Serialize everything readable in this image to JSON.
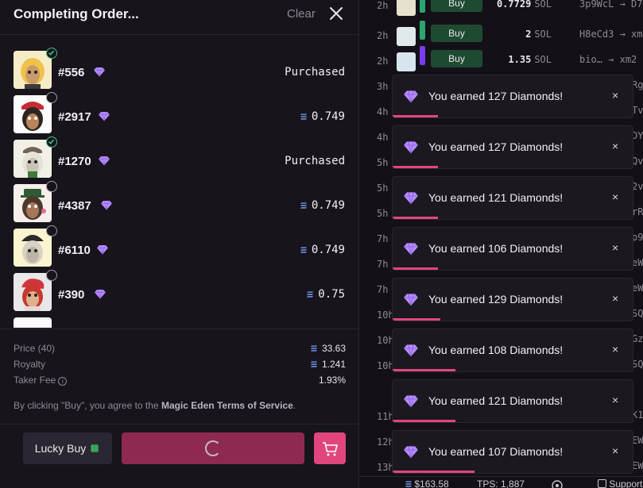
{
  "order_panel": {
    "title": "Completing Order...",
    "clear_label": "Clear",
    "items": [
      {
        "id": "#556",
        "status": "Purchased",
        "done": true
      },
      {
        "id": "#2917",
        "price": "0.749",
        "done": false
      },
      {
        "id": "#1270",
        "status": "Purchased",
        "done": true
      },
      {
        "id": "#4387",
        "price": "0.749",
        "done": false
      },
      {
        "id": "#6110",
        "price": "0.749",
        "done": false
      },
      {
        "id": "#390",
        "price": "0.75",
        "done": false
      }
    ],
    "fees": {
      "price_label": "Price (40)",
      "price_value": "33.63",
      "royalty_label": "Royalty",
      "royalty_value": "1.241",
      "taker_label": "Taker Fee",
      "taker_value": "1.93%"
    },
    "terms_prefix": "By clicking \"Buy\", you agree to the ",
    "terms_link": "Magic Eden Terms of Service",
    "terms_suffix": ".",
    "lucky_buy_label": "Lucky Buy",
    "lucky_icon": "clover-icon",
    "cart_icon": "cart-icon"
  },
  "activity": {
    "rows": [
      {
        "time": "2h",
        "action": "Buy",
        "price": "0.7729",
        "unit": "SOL",
        "from": "3p9WcL",
        "to": "D7",
        "bar_color": "#2aa66f"
      },
      {
        "time": "2h",
        "action": "Buy",
        "price": "2",
        "unit": "SOL",
        "from": "H8eCd3",
        "to": "xm2",
        "bar_color": "#2aa66f"
      },
      {
        "time": "2h",
        "action": "Buy",
        "price": "1.35",
        "unit": "SOL",
        "from": "bio…",
        "to": "xm2",
        "bar_color": "#7b3cf0"
      }
    ],
    "hidden_times": [
      "3h",
      "4h",
      "4h",
      "5h",
      "5h",
      "5h",
      "7h",
      "7h",
      "7h",
      "10h",
      "10h",
      "10h",
      "11h",
      "12h",
      "13h"
    ],
    "hidden_edges": [
      "Rg",
      "Tv",
      "DY",
      "Qv",
      "2v",
      "rR",
      "p9",
      "eW",
      "eW",
      "SQ",
      "Gz",
      "SQ",
      "K1",
      "EW",
      "EW"
    ]
  },
  "toasts": [
    {
      "text": "You earned 127 Diamonds!",
      "progress": 0.19
    },
    {
      "text": "You earned 127 Diamonds!",
      "progress": 0.19
    },
    {
      "text": "You earned 121 Diamonds!",
      "progress": 0.19
    },
    {
      "text": "You earned 106 Diamonds!",
      "progress": 0.19
    },
    {
      "text": "You earned 129 Diamonds!",
      "progress": 0.2
    },
    {
      "text": "You earned 108 Diamonds!",
      "progress": 0.26
    },
    {
      "text": "You earned 121 Diamonds!",
      "progress": 0.26
    },
    {
      "text": "You earned 107 Diamonds!",
      "progress": 0.34
    }
  ],
  "status_bar": {
    "sol_price": "$163.58",
    "tps": "TPS: 1,887",
    "support": "Support"
  },
  "colors": {
    "accent": "#e0467d",
    "buy_button": "#8e2a52",
    "success": "#3fbf8a",
    "gem": "#b78cff"
  }
}
